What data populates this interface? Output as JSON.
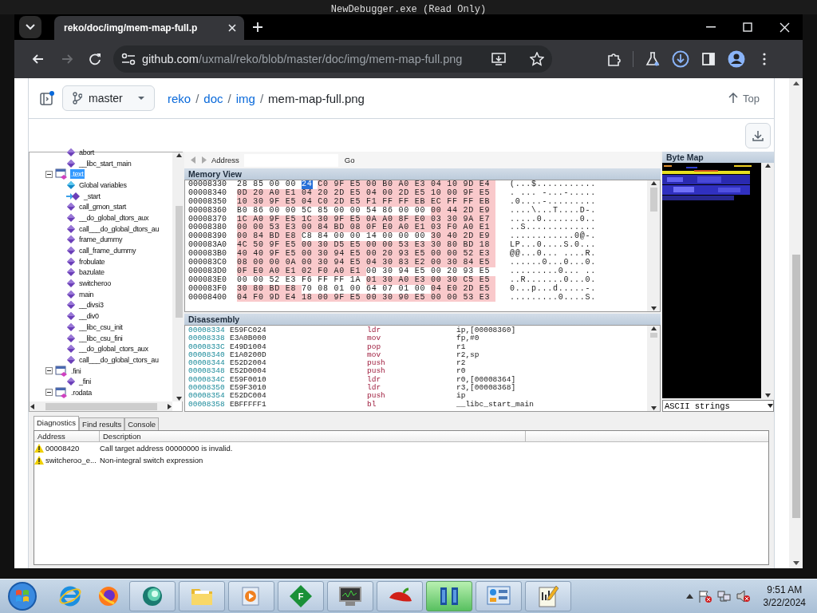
{
  "desktop": {
    "background_title": "NewDebugger.exe (Read Only)"
  },
  "browser": {
    "tab_title": "reko/doc/img/mem-map-full.p",
    "nav": [
      {
        "kind": "back",
        "disabled": false
      },
      {
        "kind": "forward",
        "disabled": true
      },
      {
        "kind": "reload",
        "disabled": false
      }
    ],
    "url_host": "github.com",
    "url_path": "/uxmal/reko/blob/master/doc/img/mem-map-full.png"
  },
  "github": {
    "branch": "master",
    "breadcrumb": [
      {
        "kind": "link",
        "text": "reko"
      },
      {
        "kind": "separator",
        "text": "/"
      },
      {
        "kind": "link",
        "text": "doc"
      },
      {
        "kind": "separator",
        "text": "/"
      },
      {
        "kind": "link",
        "text": "img"
      },
      {
        "kind": "separator",
        "text": "/"
      },
      {
        "kind": "current",
        "text": "mem-map-full.png"
      }
    ],
    "top_link": "Top"
  },
  "app": {
    "tree": {
      "continued": [
        {
          "label": "abort",
          "kind": "procedure",
          "selected": false
        },
        {
          "label": "__libc_start_main",
          "kind": "procedure",
          "selected": false
        }
      ],
      "nodes": [
        {
          "label": ".text",
          "kind": "segment",
          "selected": true,
          "expanded": true,
          "children": [
            {
              "label": "Global variables",
              "kind": "globals",
              "selected": false
            },
            {
              "label": "_start",
              "kind": "entry",
              "selected": false
            },
            {
              "label": "call_gmon_start",
              "kind": "procedure",
              "selected": false
            },
            {
              "label": "__do_global_dtors_aux",
              "kind": "procedure",
              "selected": false
            },
            {
              "label": "call___do_global_dtors_au",
              "kind": "procedure",
              "selected": false
            },
            {
              "label": "frame_dummy",
              "kind": "procedure",
              "selected": false
            },
            {
              "label": "call_frame_dummy",
              "kind": "procedure",
              "selected": false
            },
            {
              "label": "frobulate",
              "kind": "procedure",
              "selected": false
            },
            {
              "label": "bazulate",
              "kind": "procedure",
              "selected": false
            },
            {
              "label": "switcheroo",
              "kind": "procedure",
              "selected": false
            },
            {
              "label": "main",
              "kind": "procedure",
              "selected": false
            },
            {
              "label": "__divsi3",
              "kind": "procedure",
              "selected": false
            },
            {
              "label": "__div0",
              "kind": "procedure",
              "selected": false
            },
            {
              "label": "__libc_csu_init",
              "kind": "procedure",
              "selected": false
            },
            {
              "label": "__libc_csu_fini",
              "kind": "procedure",
              "selected": false
            },
            {
              "label": "__do_global_ctors_aux",
              "kind": "procedure",
              "selected": false
            },
            {
              "label": "call___do_global_ctors_au",
              "kind": "procedure",
              "selected": false
            }
          ]
        },
        {
          "label": ".fini",
          "kind": "segment",
          "selected": false,
          "expanded": true,
          "children": [
            {
              "label": "_fini",
              "kind": "procedure",
              "selected": false
            }
          ]
        },
        {
          "label": ".rodata",
          "kind": "segment",
          "selected": false,
          "expanded": true
        }
      ]
    },
    "address_bar": {
      "label": "Address",
      "go": "Go"
    },
    "memory_view": {
      "title": "Memory View",
      "rows": [
        {
          "address": "00008330",
          "segments": [
            {
              "kind": "plain",
              "text": "28 85 00 00"
            },
            {
              "kind": "cursor",
              "text": "24"
            },
            {
              "kind": "code",
              "text": "C0 9F E5 00 B0 A0 E3 04 10 9D E4"
            }
          ],
          "ascii": "(...$..........."
        },
        {
          "address": "00008340",
          "segments": [
            {
              "kind": "code",
              "text": "0D 20 A0 E1 04 20 2D E5 04 00 2D E5 10 00 9F E5"
            }
          ],
          "ascii": ". ... -...-....."
        },
        {
          "address": "00008350",
          "segments": [
            {
              "kind": "code",
              "text": "10 30 9F E5 04 C0 2D E5 F1 FF FF EB EC FF FF EB"
            }
          ],
          "ascii": ".0....-........."
        },
        {
          "address": "00008360",
          "segments": [
            {
              "kind": "plain",
              "text": "B0 86 00 00 5C 85 00 00 54 86 00 00"
            },
            {
              "kind": "code",
              "text": "00 44 2D E9"
            }
          ],
          "ascii": "....\\...T....D-."
        },
        {
          "address": "00008370",
          "segments": [
            {
              "kind": "code",
              "text": "1C A0 9F E5 1C 30 9F E5 0A A0 8F E0 03 30 9A E7"
            }
          ],
          "ascii": ".....0.......0.."
        },
        {
          "address": "00008380",
          "segments": [
            {
              "kind": "code",
              "text": "00 00 53 E3 00 84 BD 08 0F E0 A0 E1 03 F0 A0 E1"
            }
          ],
          "ascii": "..S............."
        },
        {
          "address": "00008390",
          "segments": [
            {
              "kind": "code",
              "text": "00 84 BD E8"
            },
            {
              "kind": "plain",
              "text": "C8 84 00 00 14 00 00 00"
            },
            {
              "kind": "code",
              "text": "30 40 2D E9"
            }
          ],
          "ascii": "............0@-."
        },
        {
          "address": "000083A0",
          "segments": [
            {
              "kind": "code",
              "text": "4C 50 9F E5 00 30 D5 E5 00 00 53 E3 30 80 BD 18"
            }
          ],
          "ascii": "LP...0....S.0..."
        },
        {
          "address": "000083B0",
          "segments": [
            {
              "kind": "code",
              "text": "40 40 9F E5 00 30 94 E5 00 20 93 E5 00 00 52 E3"
            }
          ],
          "ascii": "@@...0... ....R."
        },
        {
          "address": "000083C0",
          "segments": [
            {
              "kind": "code",
              "text": "08 00 00 0A 00 30 94 E5 04 30 83 E2 00 30 84 E5"
            }
          ],
          "ascii": "......0...0...0."
        },
        {
          "address": "000083D0",
          "segments": [
            {
              "kind": "code",
              "text": "0F E0 A0 E1 02 F0 A0 E1"
            },
            {
              "kind": "plain",
              "text": "00 30 94 E5 00 20 93 E5"
            }
          ],
          "ascii": ".........0... .."
        },
        {
          "address": "000083E0",
          "segments": [
            {
              "kind": "plain",
              "text": "00 00 52 E3 F6 FF FF 1A"
            },
            {
              "kind": "code",
              "text": "01 30 A0 E3 00 30 C5 E5"
            }
          ],
          "ascii": "..R.......0...0."
        },
        {
          "address": "000083F0",
          "segments": [
            {
              "kind": "code",
              "text": "30 80 BD E8"
            },
            {
              "kind": "plain",
              "text": "70 08 01 00 64 07 01 00"
            },
            {
              "kind": "code",
              "text": "04 E0 2D E5"
            }
          ],
          "ascii": "0...p...d.....-."
        },
        {
          "address": "00008400",
          "segments": [
            {
              "kind": "code",
              "text": "04 F0 9D E4 18 00 9F E5 00 30 90 E5 00 00 53 E3"
            }
          ],
          "ascii": ".........0....S."
        }
      ]
    },
    "disassembly": {
      "title": "Disassembly",
      "rows": [
        {
          "address": "00008334",
          "bytes": "E59FC024",
          "mnemonic": "ldr",
          "operands": "ip,[00008360]"
        },
        {
          "address": "00008338",
          "bytes": "E3A0B000",
          "mnemonic": "mov",
          "operands": "fp,#0"
        },
        {
          "address": "0000833C",
          "bytes": "E49D1004",
          "mnemonic": "pop",
          "operands": "r1"
        },
        {
          "address": "00008340",
          "bytes": "E1A0200D",
          "mnemonic": "mov",
          "operands": "r2,sp"
        },
        {
          "address": "00008344",
          "bytes": "E52D2004",
          "mnemonic": "push",
          "operands": "r2"
        },
        {
          "address": "00008348",
          "bytes": "E52D0004",
          "mnemonic": "push",
          "operands": "r0"
        },
        {
          "address": "0000834C",
          "bytes": "E59F0010",
          "mnemonic": "ldr",
          "operands": "r0,[00008364]"
        },
        {
          "address": "00008350",
          "bytes": "E59F3010",
          "mnemonic": "ldr",
          "operands": "r3,[00008368]"
        },
        {
          "address": "00008354",
          "bytes": "E52DC004",
          "mnemonic": "push",
          "operands": "ip"
        },
        {
          "address": "00008358",
          "bytes": "EBFFFFF1",
          "mnemonic": "bl",
          "operands": "__libc_start_main"
        }
      ]
    },
    "byte_map": {
      "title": "Byte Map",
      "mode": "ASCII strings"
    },
    "bottom_tabs": [
      {
        "label": "Diagnostics",
        "selected": true
      },
      {
        "label": "Find results",
        "selected": false
      },
      {
        "label": "Console",
        "selected": false
      }
    ],
    "diagnostics": {
      "columns": [
        "Address",
        "Description"
      ],
      "rows": [
        {
          "kind": "warning",
          "address": "00008420",
          "description": "Call target address 00000000 is invalid."
        },
        {
          "kind": "warning",
          "address": "switcheroo_e...",
          "description": "Non-integral switch expression"
        }
      ]
    }
  },
  "taskbar": {
    "apps": [
      {
        "kind": "ie",
        "selected": false
      },
      {
        "kind": "firefox",
        "selected": false
      },
      {
        "kind": "globe",
        "selected": false
      },
      {
        "kind": "folder",
        "selected": false
      },
      {
        "kind": "media",
        "selected": false
      },
      {
        "kind": "diamond",
        "label": "F",
        "selected": false
      },
      {
        "kind": "monitor",
        "selected": false
      },
      {
        "kind": "pepper",
        "selected": false
      },
      {
        "kind": "bars",
        "selected": true
      },
      {
        "kind": "panel",
        "selected": false
      },
      {
        "kind": "notepad",
        "selected": false
      }
    ],
    "time": "9:51 AM",
    "date": "3/22/2024"
  }
}
